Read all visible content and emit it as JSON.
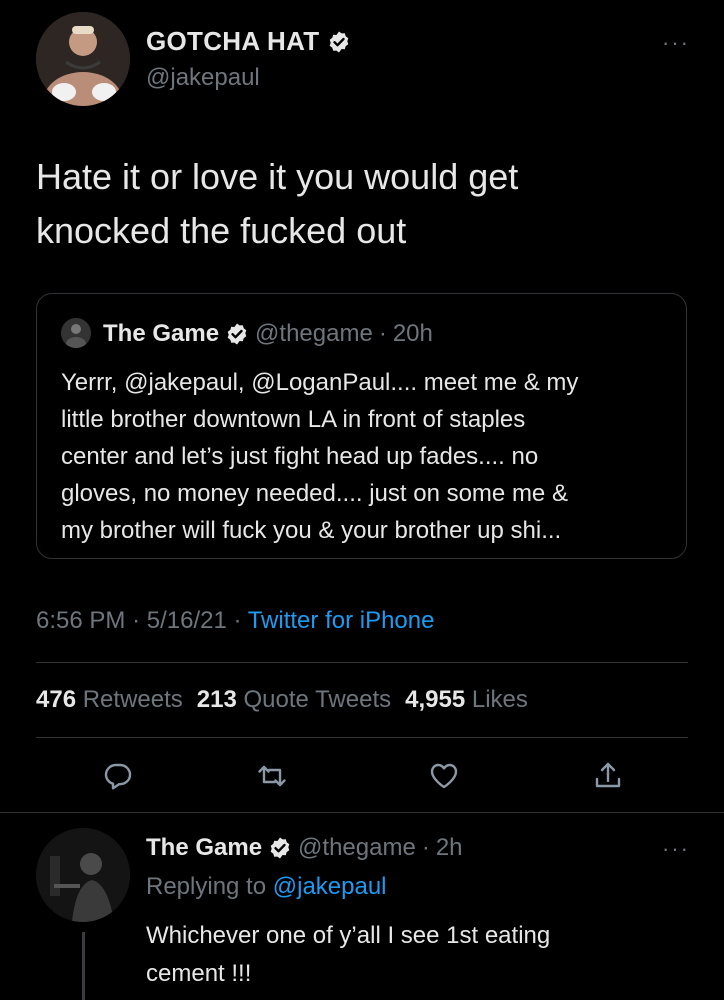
{
  "main_tweet": {
    "author_name": "GOTCHA HAT",
    "handle": "@jakepaul",
    "more": "···",
    "text_line1": "Hate it or love it you would get",
    "text_line2": "knocked the fucked out"
  },
  "quote": {
    "name": "The Game",
    "handle": "@thegame",
    "sep": "·",
    "time": "20h",
    "lines": [
      "Yerrr, @jakepaul, @LoganPaul.... meet me & my",
      "little brother downtown LA in front of staples",
      "center and let’s just fight head up fades.... no",
      "gloves, no money needed.... just on some me &",
      "my brother will fuck you & your brother up shi..."
    ]
  },
  "meta": {
    "time": "6:56 PM",
    "date": "5/16/21",
    "sep": "·",
    "source": "Twitter for iPhone"
  },
  "stats": {
    "retweets_count": "476",
    "retweets_label": "Retweets",
    "quotes_count": "213",
    "quotes_label": "Quote Tweets",
    "likes_count": "4,955",
    "likes_label": "Likes"
  },
  "reply": {
    "name": "The Game",
    "handle": "@thegame",
    "sep": "·",
    "time": "2h",
    "replying_label": "Replying to",
    "replying_handle": "@jakepaul",
    "more": "···",
    "text_line1": "Whichever one of y’all I see 1st eating",
    "text_line2": "cement !!!"
  },
  "icons": {
    "reply": "reply-icon",
    "retweet": "retweet-icon",
    "like": "heart-icon",
    "share": "share-icon",
    "verified": "verified-badge-icon"
  },
  "colors": {
    "background": "#000000",
    "text": "#e7e7e7",
    "muted": "#6e767d",
    "link": "#1d9bf0",
    "border": "#2f3336"
  }
}
